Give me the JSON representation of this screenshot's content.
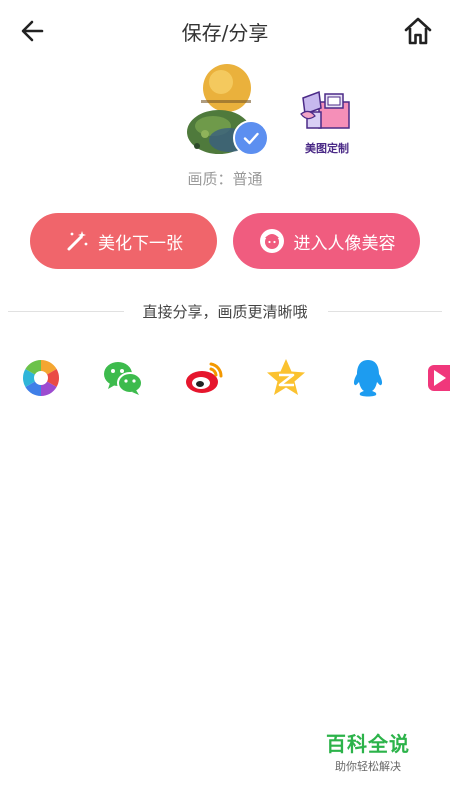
{
  "header": {
    "title": "保存/分享"
  },
  "preview": {
    "quality_label": "画质：普通"
  },
  "meitu_custom": {
    "label": "美图定制"
  },
  "actions": {
    "beautify_next": "美化下一张",
    "enter_portrait": "进入人像美容"
  },
  "share": {
    "tip": "直接分享，画质更清晰哦",
    "targets": [
      "camera-aperture-icon",
      "wechat-icon",
      "weibo-icon",
      "qzone-icon",
      "qq-icon",
      "video-app-icon"
    ]
  },
  "watermark": {
    "main": "百科全说",
    "sub": "助你轻松解决"
  },
  "colors": {
    "beautify_button": "#f0656b",
    "portrait_button": "#f05c7f",
    "check_badge": "#5c8ff0",
    "watermark_green": "#2cb34a"
  }
}
